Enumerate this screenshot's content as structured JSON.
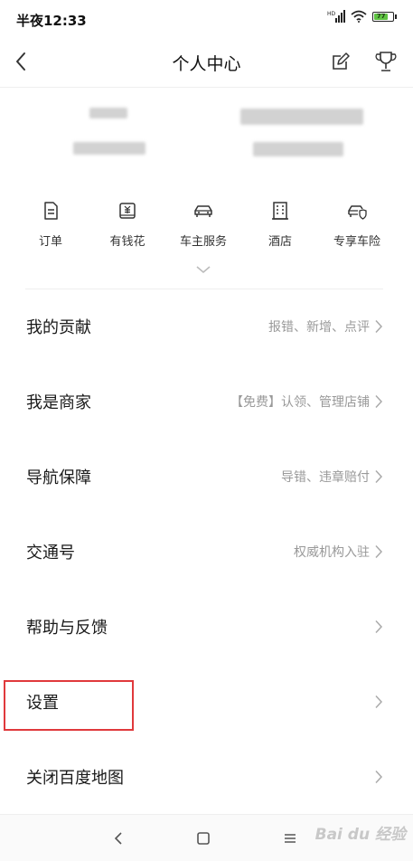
{
  "status_bar": {
    "time": "半夜12:33",
    "battery_level": "77"
  },
  "header": {
    "title": "个人中心"
  },
  "quick_actions": [
    {
      "label": "订单",
      "icon": "order-icon"
    },
    {
      "label": "有钱花",
      "icon": "wallet-icon"
    },
    {
      "label": "车主服务",
      "icon": "car-icon"
    },
    {
      "label": "酒店",
      "icon": "hotel-icon"
    },
    {
      "label": "专享车险",
      "icon": "car-insurance-icon"
    }
  ],
  "menu": [
    {
      "title": "我的贡献",
      "desc": "报错、新增、点评"
    },
    {
      "title": "我是商家",
      "desc": "【免费】认领、管理店铺"
    },
    {
      "title": "导航保障",
      "desc": "导错、违章赔付"
    },
    {
      "title": "交通号",
      "desc": "权威机构入驻"
    },
    {
      "title": "帮助与反馈",
      "desc": ""
    },
    {
      "title": "设置",
      "desc": ""
    },
    {
      "title": "关闭百度地图",
      "desc": ""
    }
  ],
  "watermark": "Bai du 经验",
  "colors": {
    "highlight": "#e0393c",
    "battery": "#5ec242",
    "secondary_text": "#999999"
  }
}
